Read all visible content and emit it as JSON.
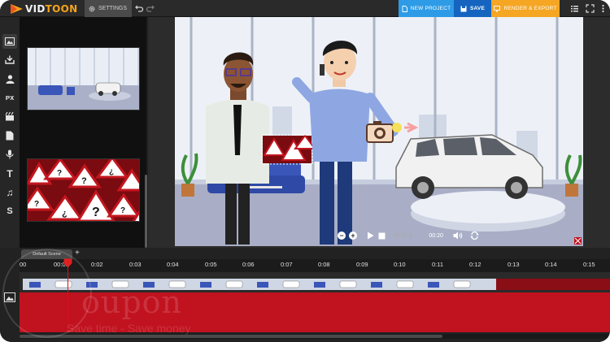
{
  "app": {
    "logo_prefix": "VID",
    "logo_suffix": "TOON"
  },
  "toolbar": {
    "settings_label": "SETTINGS",
    "new_project_label": "NEW PROJECT",
    "save_label": "SAVE",
    "render_label": "RENDER & EXPORT"
  },
  "tools": [
    {
      "icon": "background-image-icon",
      "glyph": "▣"
    },
    {
      "icon": "import-icon",
      "glyph": "⤓"
    },
    {
      "icon": "character-icon",
      "glyph": "●"
    },
    {
      "icon": "props-icon",
      "glyph": "ᴘx"
    },
    {
      "icon": "scene-props-icon",
      "glyph": "⛁"
    },
    {
      "icon": "document-icon",
      "glyph": "▤"
    },
    {
      "icon": "microphone-icon",
      "glyph": "♦"
    },
    {
      "icon": "text-icon",
      "glyph": "T"
    },
    {
      "icon": "music-icon",
      "glyph": "♫"
    },
    {
      "icon": "s-icon",
      "glyph": "S"
    }
  ],
  "player": {
    "current_time": "00:01.2",
    "total_time": "00:20"
  },
  "timeline": {
    "scene_tab": "Default Scene",
    "add_scene": "+",
    "ticks": [
      "00",
      "00:01",
      "0:02",
      "0:03",
      "0:04",
      "0:05",
      "0:06",
      "0:07",
      "0:08",
      "0:09",
      "0:10",
      "0:11",
      "0:12",
      "0:13",
      "0:14",
      "0:15"
    ],
    "playhead_seconds": 1.2
  },
  "watermark": {
    "text": "oupon",
    "subtext": "Save time - Save money"
  },
  "colors": {
    "accent_blue": "#2e9be6",
    "save_blue": "#1565c0",
    "render_orange": "#f5a623",
    "track_red": "#c1121f",
    "logo_orange": "#f5a31a"
  }
}
